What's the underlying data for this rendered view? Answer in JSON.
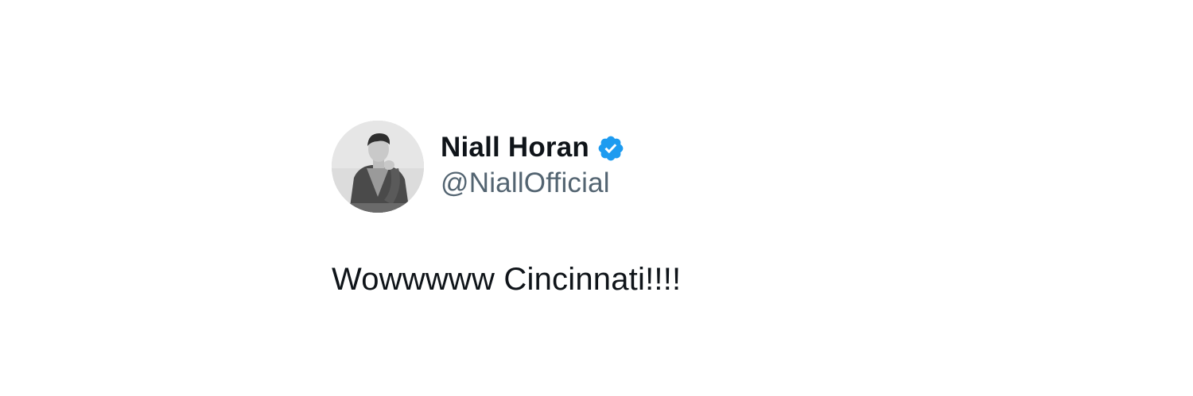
{
  "tweet": {
    "author": {
      "display_name": "Niall Horan",
      "handle": "@NiallOfficial",
      "verified": true,
      "avatar_icon": "profile-photo"
    },
    "text": "Wowwwww Cincinnati!!!!"
  },
  "colors": {
    "background": "#ffffff",
    "name": "#0f1419",
    "handle": "#536471",
    "verified_badge": "#1d9bf0"
  }
}
